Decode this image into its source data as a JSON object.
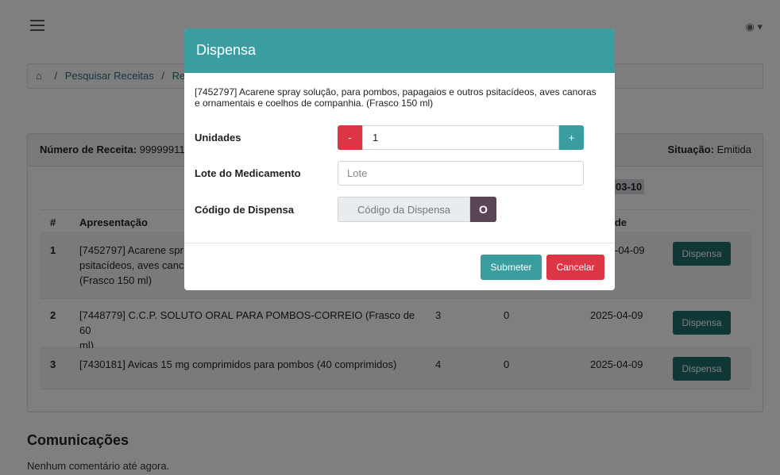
{
  "topbar": {
    "user_icon": "user-circle-icon",
    "caret": "▾"
  },
  "breadcrumb": {
    "home_icon": "home-icon",
    "item1": "Pesquisar Receitas",
    "item2": "Rec"
  },
  "prescription": {
    "number_label": "Número de Receita:",
    "number_value": "99999911",
    "status_label": "Situação:",
    "status_value": "Emitida",
    "date_label": "03-10"
  },
  "table": {
    "headers": {
      "idx": "#",
      "presentation": "Apresentação",
      "validity": "lade"
    },
    "rows": [
      {
        "idx": "1",
        "desc": "[7452797] Acarene spray solução, para pombos, papagaios e outros psitacídeos, aves canoras e ornamentais e coelhos de companhia. (Frasco 150 ml)",
        "desc_visible": [
          "[7452797] Acarene spr",
          "psitacídeos, aves canc",
          "(Frasco 150 ml)"
        ],
        "qty": "",
        "dispensed": "",
        "validity": "-04-09",
        "button": "Dispensa"
      },
      {
        "idx": "2",
        "desc_visible": [
          "[7448779] C.C.P. SOLUTO ORAL PARA POMBOS-CORREIO (Frasco de 60",
          "ml)"
        ],
        "qty": "3",
        "dispensed": "0",
        "validity": "2025-04-09",
        "button": "Dispensa"
      },
      {
        "idx": "3",
        "desc_visible": [
          "[7430181] Avicas 15 mg comprimidos para pombos (40 comprimidos)"
        ],
        "qty": "4",
        "dispensed": "0",
        "validity": "2025-04-09",
        "button": "Dispensa"
      }
    ]
  },
  "comms": {
    "title": "Comunicações",
    "empty": "Nenhum comentário até agora."
  },
  "modal": {
    "title": "Dispensa",
    "description": "[7452797] Acarene spray solução, para pombos, papagaios e outros psitacídeos, aves canoras e ornamentais e coelhos de companhia. (Frasco 150 ml)",
    "units_label": "Unidades",
    "units_value": "1",
    "minus": "-",
    "plus": "+",
    "lote_label": "Lote do Medicamento",
    "lote_placeholder": "Lote",
    "code_label": "Código de Dispensa",
    "code_placeholder": "Código da Dispensa",
    "code_button": "O",
    "submit": "Submeter",
    "cancel": "Cancelar"
  },
  "colors": {
    "primary": "#3a9ea0",
    "danger": "#dc3545",
    "dark_teal": "#1e6f6d"
  }
}
